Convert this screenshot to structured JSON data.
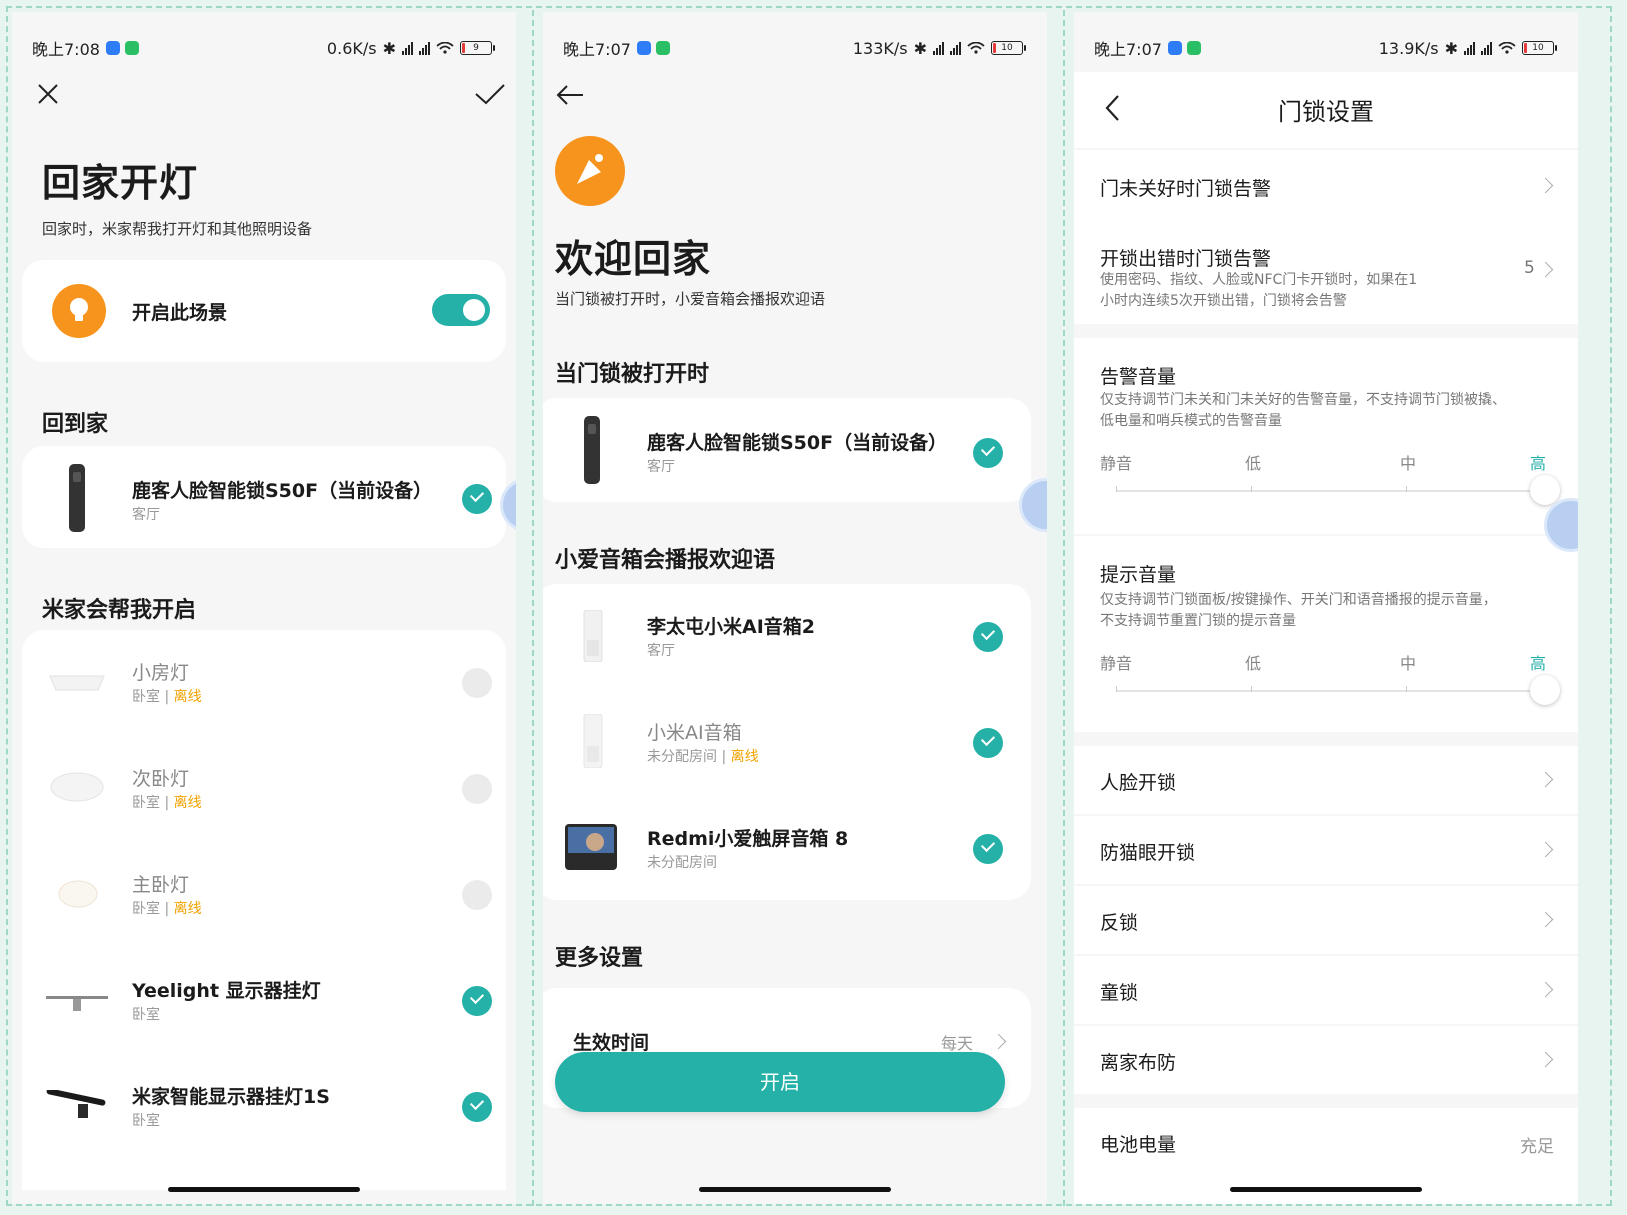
{
  "screen1": {
    "status": {
      "time": "晚上7:08",
      "speed": "0.6K/s",
      "battery": "9"
    },
    "title": "回家开灯",
    "subtitle": "回家时，米家帮我打开灯和其他照明设备",
    "scene_toggle": {
      "label": "开启此场景",
      "on": true
    },
    "section_home": "回到家",
    "lock": {
      "name": "鹿客人脸智能锁S50F（当前设备）",
      "room": "客厅"
    },
    "section_open": "米家会帮我开启",
    "devices": [
      {
        "name": "小房灯",
        "room": "卧室",
        "status": "离线",
        "checked": false
      },
      {
        "name": "次卧灯",
        "room": "卧室",
        "status": "离线",
        "checked": false
      },
      {
        "name": "主卧灯",
        "room": "卧室",
        "status": "离线",
        "checked": false
      },
      {
        "name": "Yeelight 显示器挂灯",
        "room": "卧室",
        "status": "",
        "checked": true
      },
      {
        "name": "米家智能显示器挂灯1S",
        "room": "卧室",
        "status": "",
        "checked": true
      }
    ],
    "separator": "|"
  },
  "screen2": {
    "status": {
      "time": "晚上7:07",
      "speed": "133K/s",
      "battery": "10"
    },
    "title": "欢迎回家",
    "subtitle": "当门锁被打开时，小爱音箱会播报欢迎语",
    "section_trigger": "当门锁被打开时",
    "lock": {
      "name": "鹿客人脸智能锁S50F（当前设备）",
      "room": "客厅"
    },
    "section_speakers": "小爱音箱会播报欢迎语",
    "speakers": [
      {
        "name": "李太屯小米AI音箱2",
        "room": "客厅",
        "status": ""
      },
      {
        "name": "小米AI音箱",
        "room": "未分配房间",
        "status": "离线"
      },
      {
        "name": "Redmi小爱触屏音箱 8",
        "room": "未分配房间",
        "status": ""
      }
    ],
    "section_more": "更多设置",
    "effective_time": {
      "label": "生效时间",
      "value": "每天"
    },
    "enable_button": "开启",
    "separator": "|"
  },
  "screen3": {
    "status": {
      "time": "晚上7:07",
      "speed": "13.9K/s",
      "battery": "10"
    },
    "header": "门锁设置",
    "rows": {
      "door_unclosed": "门未关好时门锁告警",
      "unlock_error": {
        "label": "开锁出错时门锁告警",
        "desc1": "使用密码、指纹、人脸或NFC门卡开锁时，如果在1",
        "desc2": "小时内连续5次开锁出错，门锁将会告警",
        "value": "5"
      },
      "alarm_volume": {
        "label": "告警音量",
        "desc1": "仅支持调节门未关和门未关好的告警音量，不支持调节门锁被撬、",
        "desc2": "低电量和哨兵模式的告警音量",
        "levels": [
          "静音",
          "低",
          "中",
          "高"
        ],
        "selected": "高"
      },
      "prompt_volume": {
        "label": "提示音量",
        "desc1": "仅支持调节门锁面板/按键操作、开关门和语音播报的提示音量，",
        "desc2": "不支持调节重置门锁的提示音量",
        "levels": [
          "静音",
          "低",
          "中",
          "高"
        ],
        "selected": "高"
      },
      "face_unlock": "人脸开锁",
      "anti_peephole": "防猫眼开锁",
      "deadlock": "反锁",
      "child_lock": "童锁",
      "away_arm": "离家布防",
      "battery": {
        "label": "电池电量",
        "value": "充足"
      }
    }
  },
  "colors": {
    "teal": "#25b1a8",
    "orange": "#f7941d",
    "offline": "#f2a200",
    "blue_icon": "#2f7df6",
    "green_icon": "#2bbf65"
  }
}
